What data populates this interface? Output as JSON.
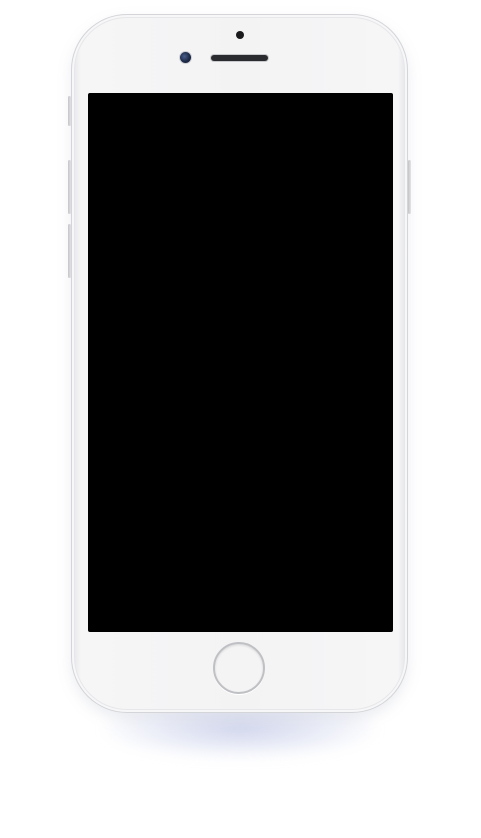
{
  "device": {
    "type": "smartphone",
    "color": "#f3f3f4",
    "screen_color": "#000000",
    "screen_content": "",
    "icons": {
      "camera": "front-camera-icon",
      "speaker": "earpiece-speaker-icon",
      "sensor": "proximity-sensor-icon",
      "home": "home-button"
    }
  }
}
